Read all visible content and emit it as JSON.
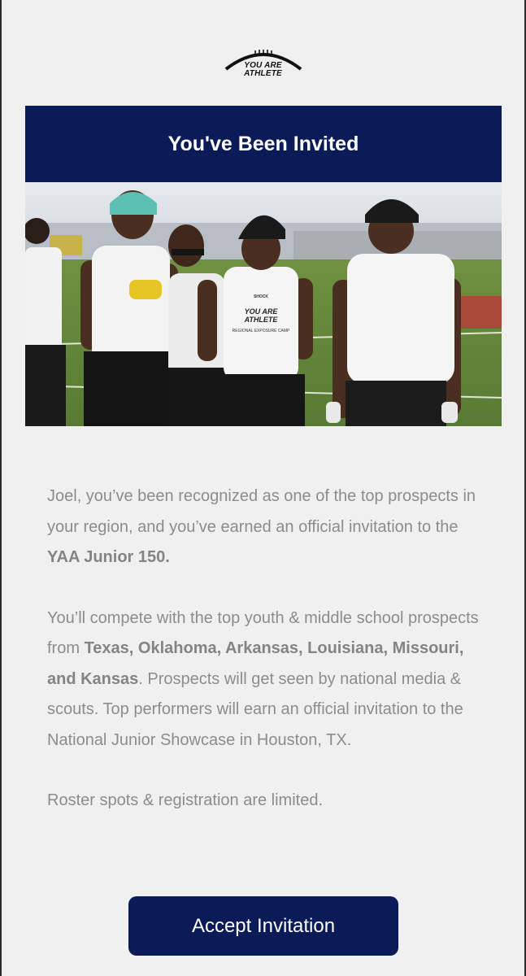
{
  "logo": {
    "line1": "YOU ARE",
    "line2": "ATHLETE"
  },
  "header": {
    "title": "You've Been Invited"
  },
  "hero": {
    "shirt_logo_line1": "YOU ARE",
    "shirt_logo_line2": "ATHLETE",
    "shirt_caption": "REGIONAL EXPOSURE CAMP",
    "shirt_brand": "SHOCK"
  },
  "body": {
    "p1_pre": "Joel, you’ve been recognized as one of the top prospects in your region, and you’ve earned an official invitation to the ",
    "p1_bold": "YAA Junior 150.",
    "p2_pre": "You’ll compete with the top youth & middle school prospects from ",
    "p2_bold": "Texas, Oklahoma, Arkansas, Louisiana, Missouri, and Kansas",
    "p2_post": ". Prospects will get seen by national media & scouts. Top performers will earn an official invitation to the National Junior Showcase in Houston, TX.",
    "p3": "Roster spots & registration are limited."
  },
  "cta": {
    "label": "Accept Invitation"
  },
  "colors": {
    "navy": "#0b1b57",
    "background": "#f0f0f0",
    "body_text": "#8c8c8c"
  }
}
